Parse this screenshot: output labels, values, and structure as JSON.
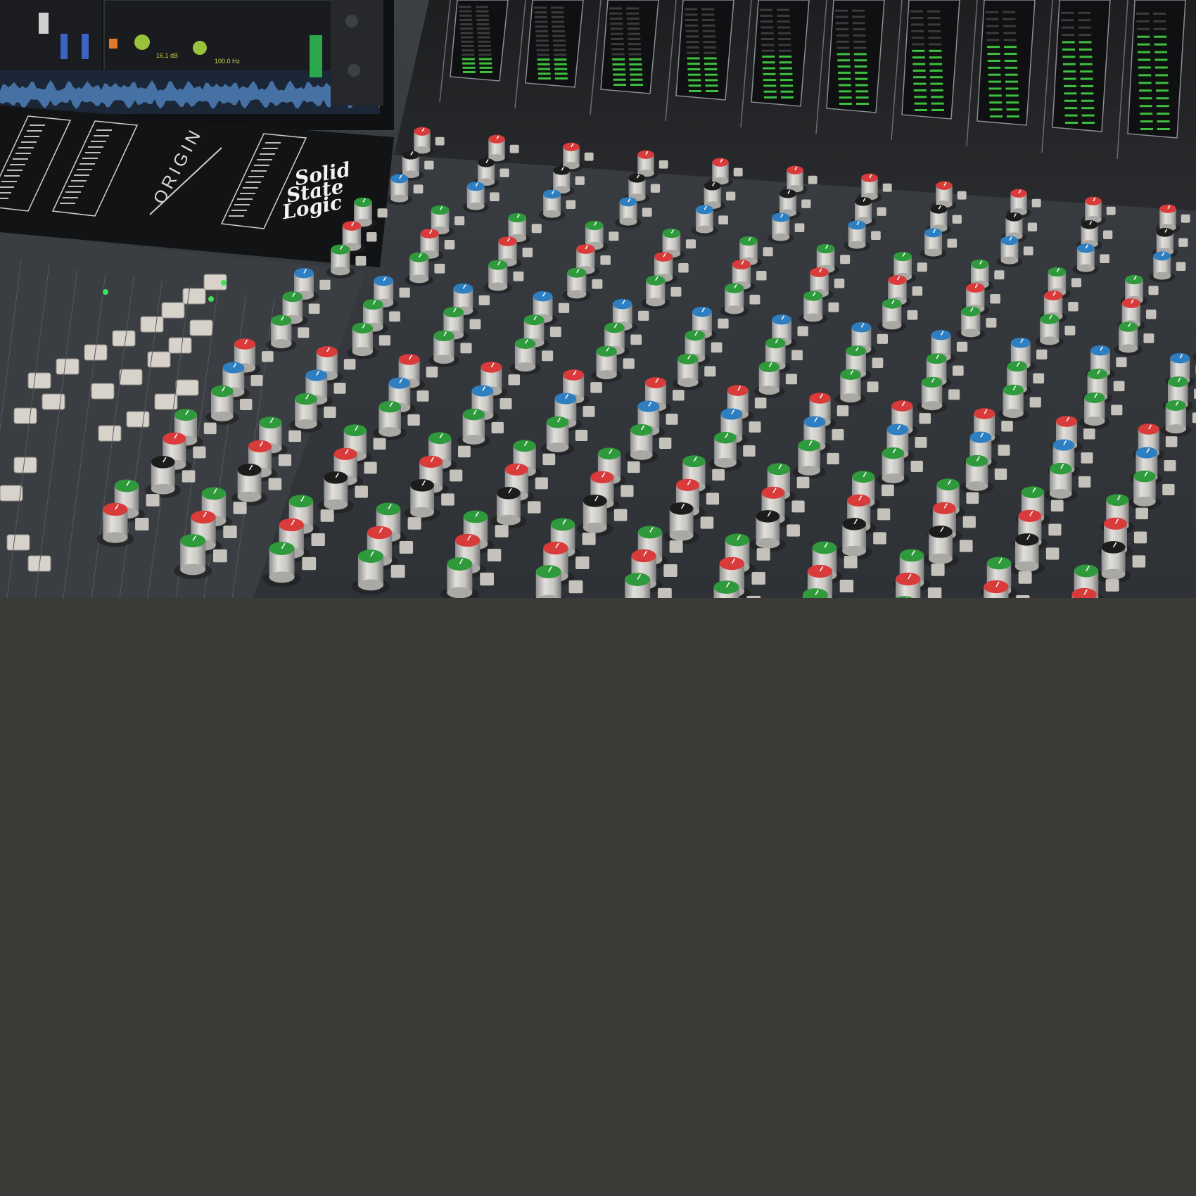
{
  "photo": {
    "subject": "Solid State Logic ORIGIN analog mixing console",
    "brand_lines": [
      "Solid",
      "State",
      "Logic"
    ],
    "model_label": "ORIGIN",
    "screen_readouts": [
      "16.1 dB",
      "100.0 Hz"
    ],
    "knob_cap_colors": [
      "#d93a3a",
      "#2f9a3c",
      "#2e7fc1",
      "#1c1c1c"
    ]
  },
  "background": {
    "color": "#3b3a36"
  }
}
